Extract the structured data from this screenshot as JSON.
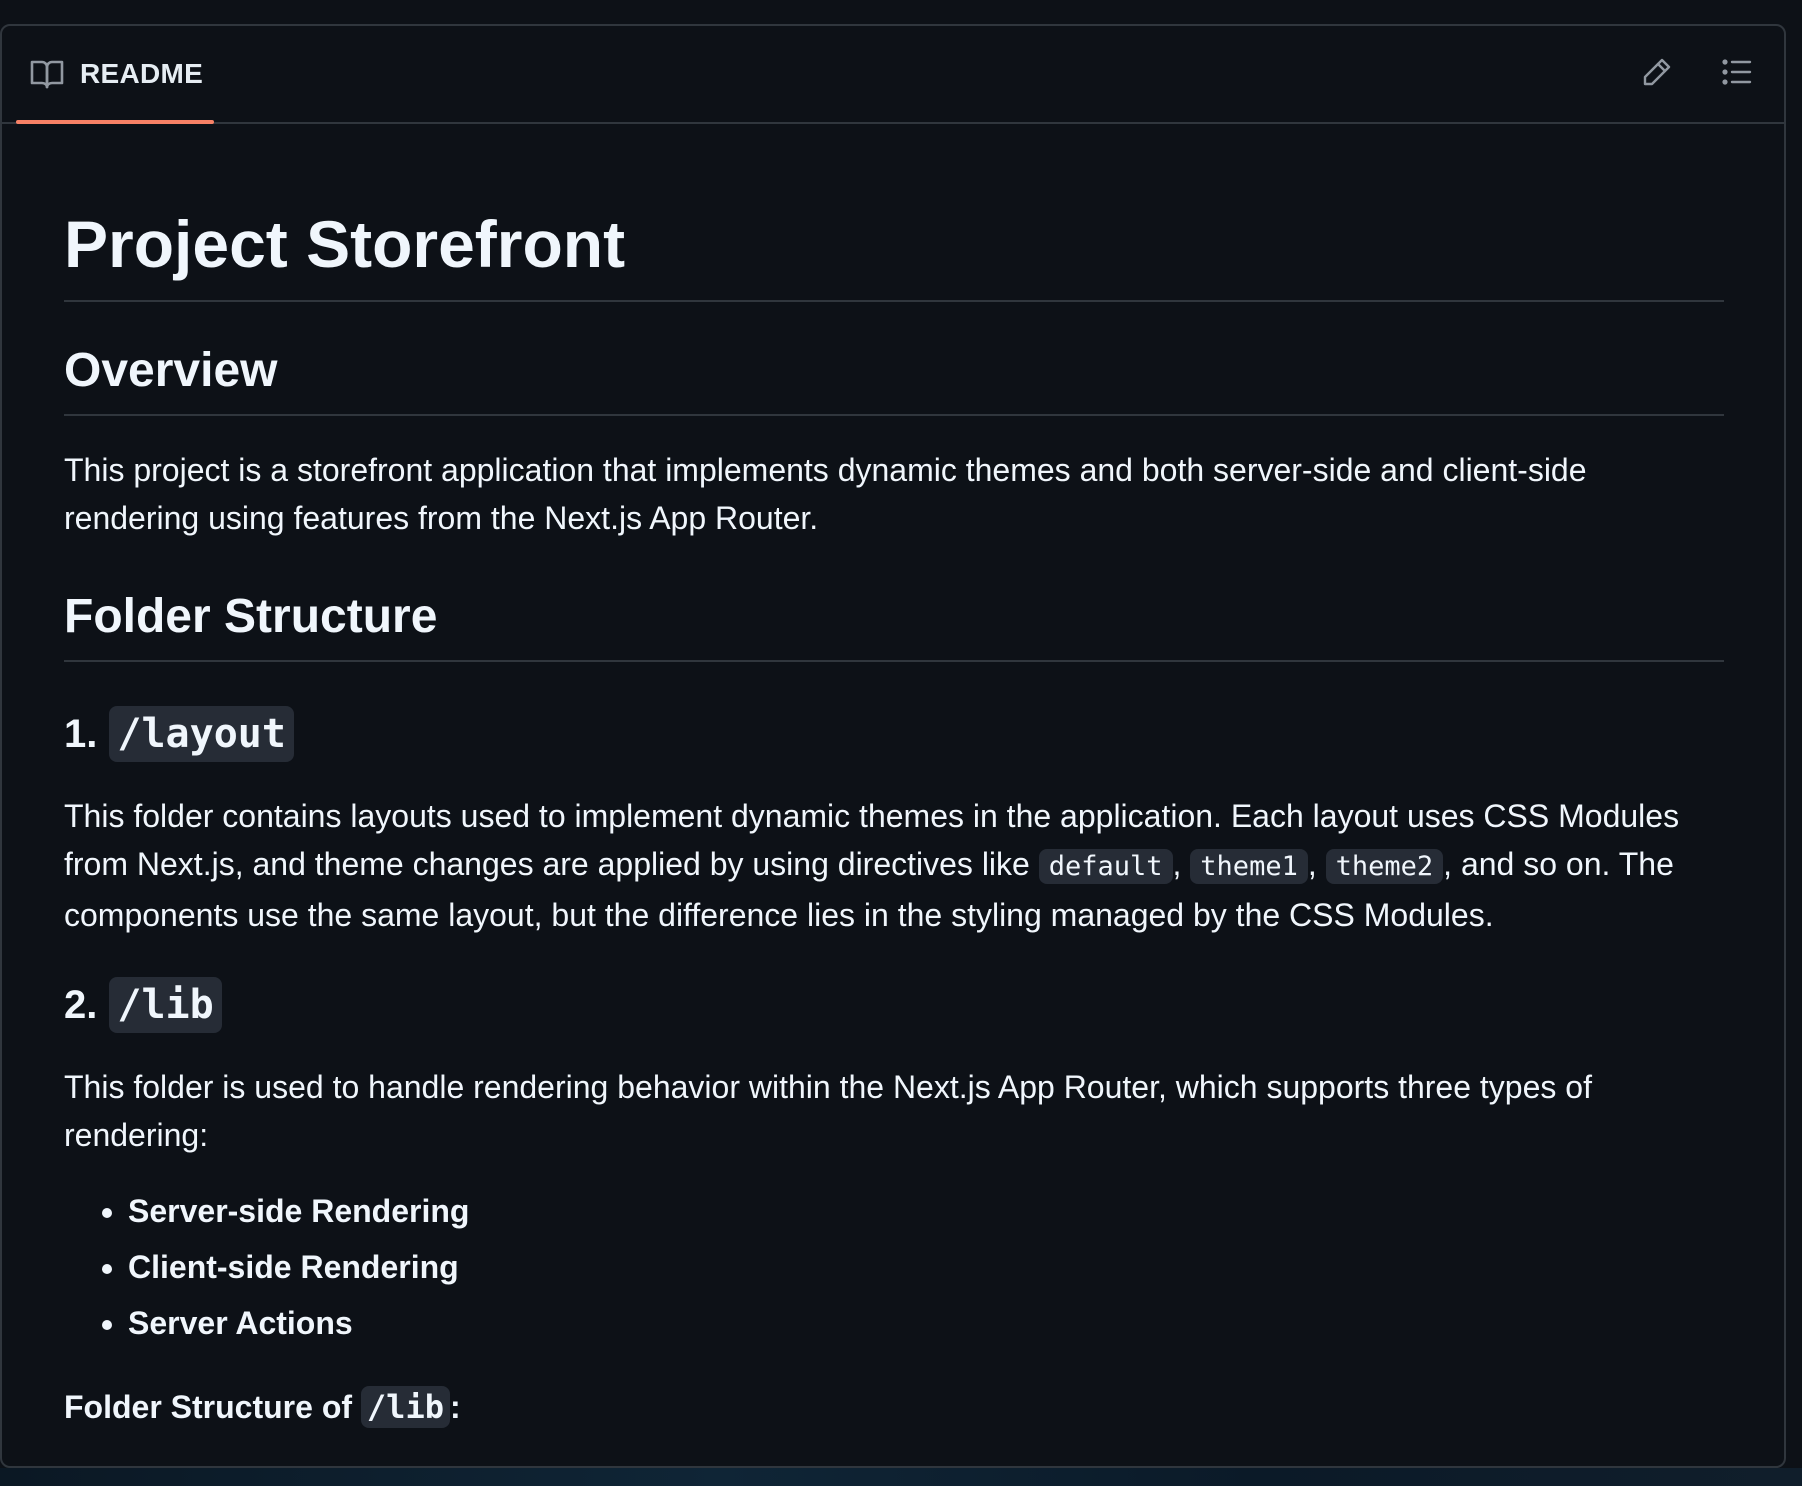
{
  "header": {
    "tab_label": "README",
    "tab_icon": "book-icon",
    "edit_icon": "pencil-icon",
    "outline_icon": "list-unordered-icon",
    "accent_color": "#f78166"
  },
  "content": {
    "title": "Project Storefront",
    "overview": {
      "heading": "Overview",
      "text": "This project is a storefront application that implements dynamic themes and both server-side and client-side rendering using features from the Next.js App Router."
    },
    "folder_structure": {
      "heading": "Folder Structure",
      "layout": {
        "number": "1.",
        "name": "/layout",
        "text_before": "This folder contains layouts used to implement dynamic themes in the application. Each layout uses CSS Modules from Next.js, and theme changes are applied by using directives like ",
        "code1": "default",
        "sep1": ", ",
        "code2": "theme1",
        "sep2": ", ",
        "code3": "theme2",
        "text_after": ", and so on. The components use the same layout, but the difference lies in the styling managed by the CSS Modules."
      },
      "lib": {
        "number": "2.",
        "name": "/lib",
        "text": "This folder is used to handle rendering behavior within the Next.js App Router, which supports three types of rendering:",
        "items": [
          "Server-side Rendering",
          "Client-side Rendering",
          "Server Actions"
        ],
        "structure_label": "Folder Structure of ",
        "structure_code": "/lib",
        "structure_suffix": ":"
      }
    }
  }
}
